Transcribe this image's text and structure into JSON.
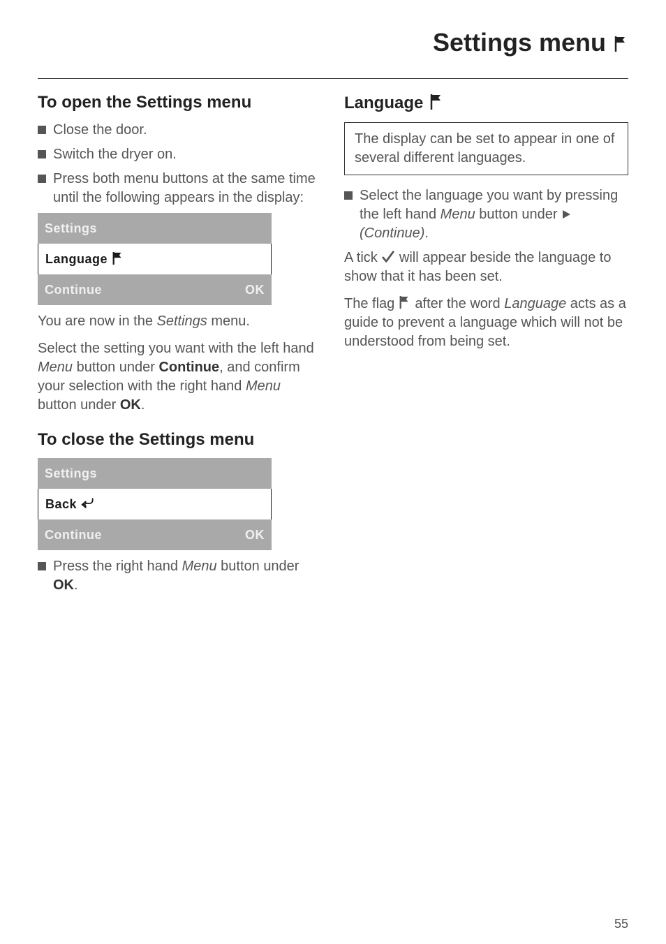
{
  "page_title": "Settings menu",
  "left": {
    "h_open": "To open the Settings menu",
    "b1": "Close the door.",
    "b2": "Switch the dryer on.",
    "b3": "Press both menu buttons at the same time until the following appears in the display:",
    "lcd1": {
      "r1": "Settings",
      "r2": "Language",
      "r3a": "Continue",
      "r3b": "OK"
    },
    "after_lcd1_a": "You are now in the ",
    "after_lcd1_b": "Settings",
    "after_lcd1_c": " menu.",
    "p2_a": "Select the setting you want with the left hand ",
    "p2_b": "Menu",
    "p2_c": " button under ",
    "p2_d": "Continue",
    "p2_e": ", and confirm your selection with the right hand ",
    "p2_f": "Menu",
    "p2_g": " button under ",
    "p2_h": "OK",
    "p2_i": ".",
    "h_close": "To close the Settings menu",
    "lcd2": {
      "r1": "Settings",
      "r2": "Back",
      "r3a": "Continue",
      "r3b": "OK"
    },
    "b4_a": "Press the right hand ",
    "b4_b": "Menu",
    "b4_c": " button under ",
    "b4_d": "OK",
    "b4_e": "."
  },
  "right": {
    "h_lang": "Language",
    "box": "The display can be set to appear in one of several different languages.",
    "b1_a": "Select the language you want by pressing the left hand ",
    "b1_b": "Menu",
    "b1_c": " button under ",
    "b1_d": "(Continue)",
    "b1_e": ".",
    "p1_a": "A tick ",
    "p1_b": " will appear beside the language to show that it has been set.",
    "p2_a": "The flag ",
    "p2_b": " after the word ",
    "p2_c": "Language",
    "p2_d": " acts as a guide to prevent a language which will not be understood from being set."
  },
  "page_number": "55"
}
